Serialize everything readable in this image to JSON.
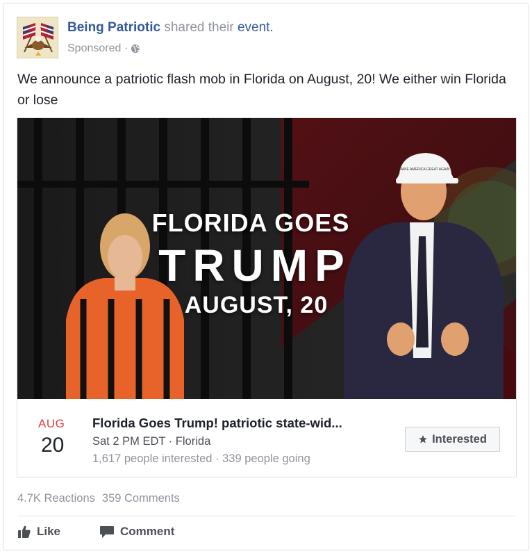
{
  "post": {
    "page_name": "Being Patriotic",
    "shared_text": "shared their",
    "event_link": "event.",
    "sponsored": "Sponsored · ",
    "message": "We announce a patriotic flash mob in Florida on August, 20! We either win Florida or lose",
    "avatar_icon": "patriotic-flags-eagle-logo",
    "privacy_icon": "globe-icon"
  },
  "event": {
    "banner": {
      "line1": "FLORIDA GOES",
      "line2": "TRUMP",
      "line3": "AUGUST, 20"
    },
    "cap_text": "MAKE AMERICA GREAT AGAIN",
    "month": "AUG",
    "day": "20",
    "title": "Florida Goes Trump! patriotic state-wid...",
    "time_location": "Sat 2 PM EDT · Florida",
    "stats": "1,617 people interested · 339 people going",
    "interested_label": "Interested",
    "interested_icon": "star-icon"
  },
  "footer": {
    "reactions": "4.7K Reactions",
    "comments": "359 Comments",
    "like_label": "Like",
    "comment_label": "Comment",
    "like_icon": "thumbs-up-icon",
    "comment_icon": "speech-bubble-icon"
  },
  "colors": {
    "link_blue": "#365899",
    "meta_gray": "#90949c",
    "month_red": "#e03d3d"
  }
}
